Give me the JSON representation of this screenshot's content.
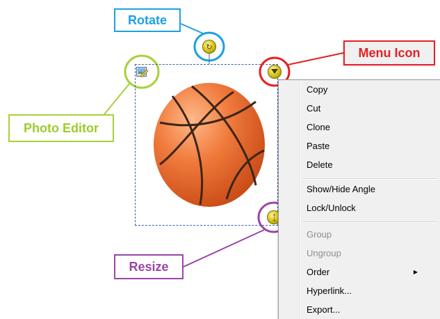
{
  "callouts": {
    "rotate": "Rotate",
    "menu_icon": "Menu Icon",
    "photo_editor": "Photo Editor",
    "resize": "Resize"
  },
  "colors": {
    "rotate": "#1ca1e2",
    "menu_icon": "#e62025",
    "photo_editor": "#a8d13a",
    "resize": "#9a46a8",
    "selection": "#3d5dae"
  },
  "image": {
    "subject": "basketball"
  },
  "handles": {
    "rotate": "rotate-handle-icon",
    "menu": "menu-dropdown-icon",
    "resize": "resize-handle-icon",
    "photo_editor": "photo-editor-icon"
  },
  "context_menu": {
    "items": [
      {
        "label": "Copy"
      },
      {
        "label": "Cut"
      },
      {
        "label": "Clone"
      },
      {
        "label": "Paste"
      },
      {
        "label": "Delete"
      },
      {
        "label": "Show/Hide Angle"
      },
      {
        "label": "Lock/Unlock"
      },
      {
        "label": "Group",
        "disabled": true
      },
      {
        "label": "Ungroup",
        "disabled": true
      },
      {
        "label": "Order",
        "submenu": true
      },
      {
        "label": "Hyperlink..."
      },
      {
        "label": "Export..."
      }
    ]
  }
}
